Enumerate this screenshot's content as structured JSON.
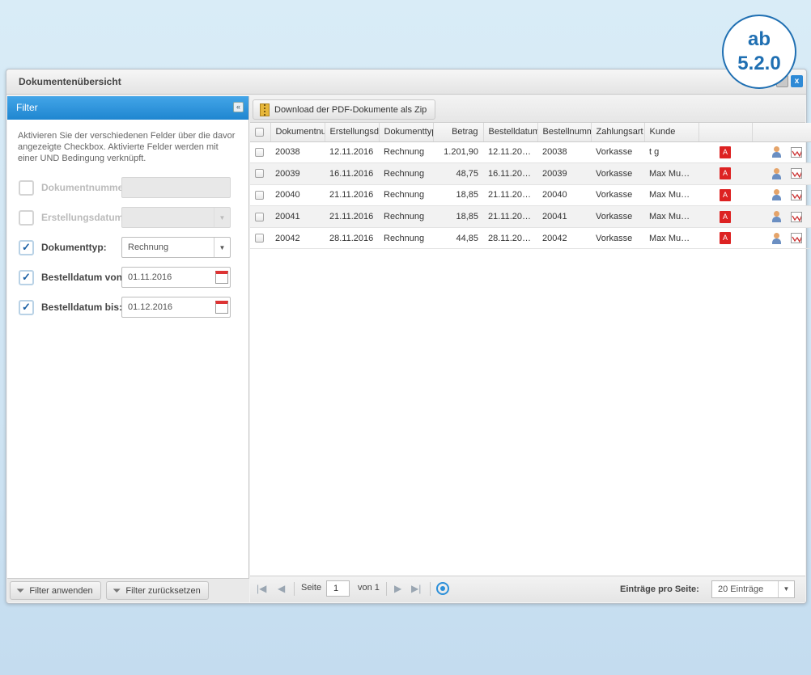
{
  "badge": {
    "line1": "ab",
    "line2": "5.2.0"
  },
  "window": {
    "title": "Dokumentenübersicht",
    "close_glyph": "x"
  },
  "filter": {
    "title": "Filter",
    "collapse_glyph": "«",
    "hint": "Aktivieren Sie der verschiedenen Felder über die davor angezeigte Checkbox. Aktivierte Felder werden mit einer UND Bedingung verknüpft.",
    "fields": [
      {
        "label": "Dokumentnummer",
        "checked": false,
        "value": "",
        "enabled": false
      },
      {
        "label": "Erstellungsdatum:",
        "checked": false,
        "value": "",
        "enabled": false
      },
      {
        "label": "Dokumenttyp:",
        "checked": true,
        "value": "Rechnung",
        "enabled": true
      },
      {
        "label": "Bestelldatum von:",
        "checked": true,
        "value": "01.11.2016",
        "enabled": true
      },
      {
        "label": "Bestelldatum bis:",
        "checked": true,
        "value": "01.12.2016",
        "enabled": true
      }
    ],
    "check_glyph": "✓",
    "apply_label": "Filter anwenden",
    "reset_label": "Filter zurücksetzen"
  },
  "toolbar": {
    "download_label": "Download der PDF-Dokumente als Zip"
  },
  "grid": {
    "columns": [
      "Dokumentnu",
      "Erstellungsd",
      "Dokumenttyp",
      "Betrag",
      "Bestelldatum",
      "Bestellnumm",
      "Zahlungsart",
      "Kunde"
    ],
    "rows": [
      [
        "20038",
        "12.11.2016",
        "Rechnung",
        "1.201,90",
        "12.11.20…",
        "20038",
        "Vorkasse",
        "t g"
      ],
      [
        "20039",
        "16.11.2016",
        "Rechnung",
        "48,75",
        "16.11.20…",
        "20039",
        "Vorkasse",
        "Max Mus…"
      ],
      [
        "20040",
        "21.11.2016",
        "Rechnung",
        "18,85",
        "21.11.20…",
        "20040",
        "Vorkasse",
        "Max Mus…"
      ],
      [
        "20041",
        "21.11.2016",
        "Rechnung",
        "18,85",
        "21.11.20…",
        "20041",
        "Vorkasse",
        "Max Mus…"
      ],
      [
        "20042",
        "28.11.2016",
        "Rechnung",
        "44,85",
        "28.11.20…",
        "20042",
        "Vorkasse",
        "Max Mus…"
      ]
    ],
    "pdf_glyph": "A"
  },
  "pager": {
    "page_label": "Seite",
    "page_value": "1",
    "of_label": "von 1",
    "per_page_label": "Einträge pro Seite:",
    "per_page_value": "20 Einträge",
    "first_glyph": "|◀",
    "prev_glyph": "◀",
    "next_glyph": "▶",
    "last_glyph": "▶|"
  },
  "icons": [
    "zip-icon",
    "pdf-icon",
    "user-icon",
    "chart-icon",
    "funnel-icon",
    "calendar-icon",
    "refresh-icon",
    "chevron-down-icon"
  ],
  "colors": {
    "accent": "#1f86d0",
    "badge": "#1f6fb2",
    "pdf": "#dd2222"
  }
}
